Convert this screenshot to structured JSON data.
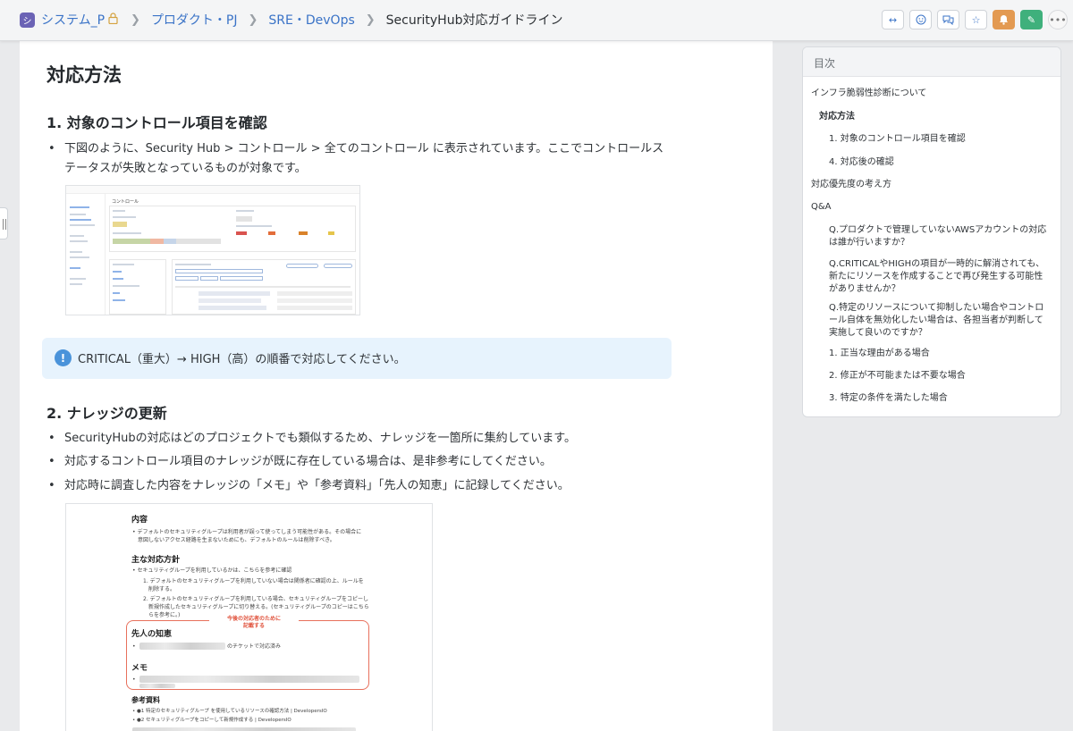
{
  "breadcrumb": {
    "space": "システム_P",
    "space_badge": "シ",
    "items": [
      "プロダクト・PJ",
      "SRE・DevOps"
    ],
    "current": "SecurityHub対応ガイドライン"
  },
  "header_actions": [
    "link-icon",
    "emoji-icon",
    "comment-icon",
    "star-icon",
    "bell-icon",
    "edit-icon",
    "more-icon"
  ],
  "article": {
    "title": "対応方法",
    "section1": {
      "heading": "1. 対象のコントロール項目を確認",
      "bullet": "下図のように、Security Hub > コントロール > 全てのコントロール に表示されています。ここでコントロールステータスが失敗となっているものが対象です。"
    },
    "info": "CRITICAL（重大）→ HIGH（高）の順番で対応してください。",
    "section2": {
      "heading": "2. ナレッジの更新",
      "bullets": [
        "SecurityHubの対応はどのプロジェクトでも類似するため、ナレッジを一箇所に集約しています。",
        "対応するコントロール項目のナレッジが既に存在している場合は、是非参考にしてください。",
        "対応時に調査した内容をナレッジの「メモ」や「参考資料」「先人の知恵」に記録してください。"
      ]
    },
    "screenshot1": {
      "title": "コントロール"
    },
    "screenshot2": {
      "content_heading": "内容",
      "content_text": [
        "デフォルトのセキュリティグループは利用者が誤って使ってしまう可能性がある。その場合に",
        "意図しないアクセス経路を生まないためにも、デフォルトのルールは削除すべき。"
      ],
      "policy_heading": "主な対応方針",
      "policy_items": [
        "セキュリティグループを利用しているかは、こちらを参考に確認",
        "1. デフォルトのセキュリティグループを利用していない場合は関係者に確認の上、ルールを",
        "削除する。",
        "2. デフォルトのセキュリティグループを利用している場合、セキュリティグループをコピーし",
        "新規作成したセキュリティグループに切り替える。(セキュリティグループのコピーはこちら",
        "らを参考に。)"
      ],
      "note": "今後の対応者のために\n記載する",
      "wisdom_heading": "先人の知恵",
      "wisdom_text": "のチケットで対応済み",
      "memo_heading": "メモ",
      "refs_heading": "参考資料",
      "refs": [
        "●1 特定のセキュリティグループ を使用しているリソースの確認方法 | DevelopersIO",
        "●2 セキュリティグループをコピーして新規作成する | DevelopersIO"
      ]
    }
  },
  "toc": {
    "title": "目次",
    "items": [
      {
        "label": "インフラ脆弱性診断について",
        "level": 1
      },
      {
        "label": "対応方法",
        "level": 2
      },
      {
        "label": "1. 対象のコントロール項目を確認",
        "level": 3
      },
      {
        "label": "4. 対応後の確認",
        "level": 3
      },
      {
        "label": "対応優先度の考え方",
        "level": 1
      },
      {
        "label": "Q&A",
        "level": 1
      },
      {
        "label": "Q.プロダクトで管理していないAWSアカウントの対応は誰が行いますか？",
        "level": 3
      },
      {
        "label": "Q.CRITICALやHIGHの項目が一時的に解消されても、新たにリソースを作成することで再び発生する可能性がありませんか？",
        "level": 3
      },
      {
        "label": "Q.特定のリソースについて抑制したい場合やコントロール自体を無効化したい場合は、各担当者が判断して実施して良いのですか？",
        "level": 3
      },
      {
        "label": "1. 正当な理由がある場合",
        "level": 3
      },
      {
        "label": "2. 修正が不可能または不要な場合",
        "level": 3
      },
      {
        "label": "3. 特定の条件を満たした場合",
        "level": 3
      }
    ]
  },
  "colors": {
    "link": "#3a73c7",
    "info_bg": "#e7f3fd",
    "info_icon": "#4a93da",
    "bell": "#e39a52",
    "edit": "#3fb07c",
    "highlight_frame": "#e8705c"
  }
}
